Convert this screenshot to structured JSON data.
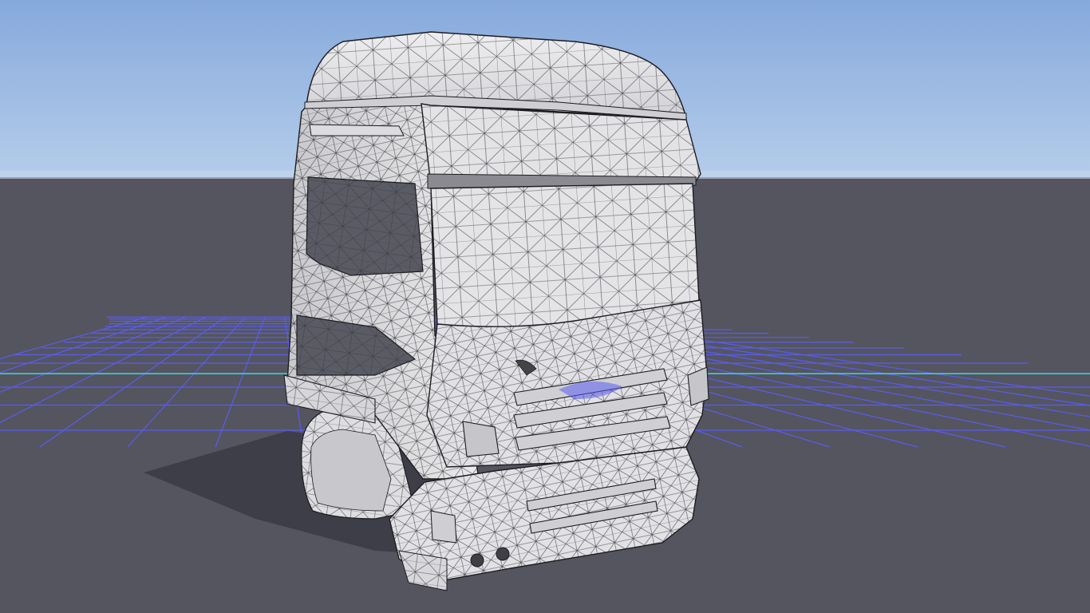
{
  "viewport": {
    "view_mode": "wireframe-on-shaded",
    "model": "truck-cab",
    "grid": "shown"
  },
  "colors": {
    "sky_top": "#86a9dc",
    "sky_horizon": "#b5cdea",
    "ground": "#54555f",
    "grid_line": "#5a5cf0",
    "axis_x": "#3fd7e6",
    "axis_z": "#3fd7e6",
    "mesh_fill": "#e6e6e8",
    "mesh_shade": "#c4c4c8",
    "mesh_wire": "#1c1c20",
    "shadow": "#3a3b44"
  }
}
